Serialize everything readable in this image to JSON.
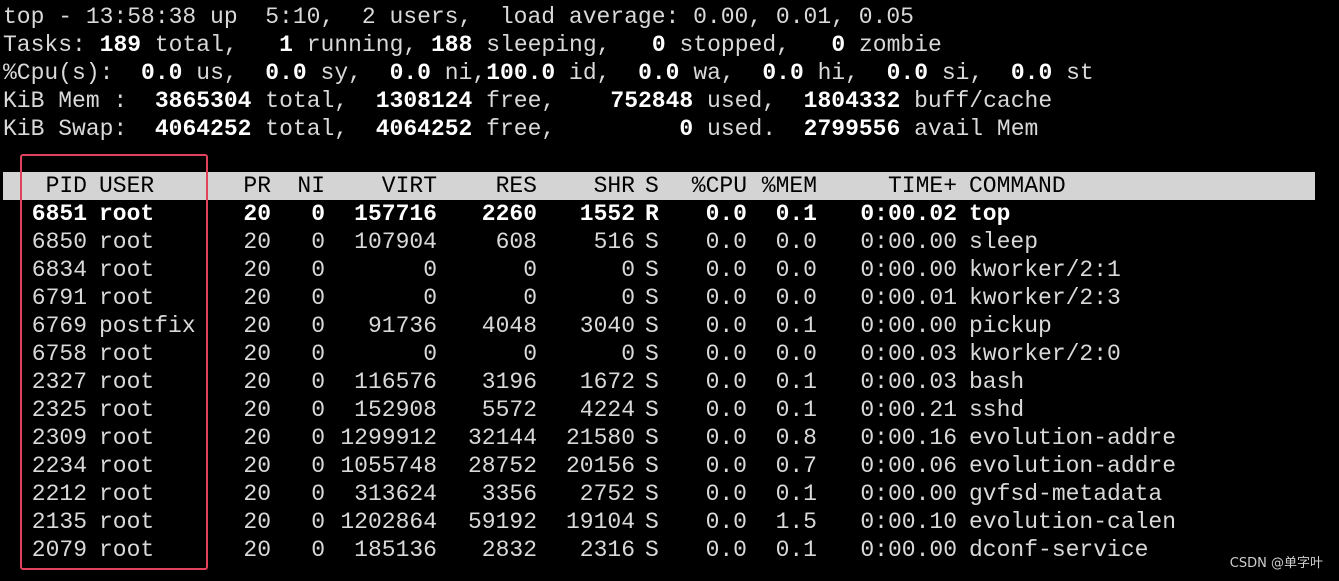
{
  "summary": {
    "line1": "top - 13:58:38 up  5:10,  2 users,  load average: 0.00, 0.01, 0.05",
    "tasks": {
      "label": "Tasks:",
      "total": "189",
      "total_label": "total,",
      "running": "1",
      "running_label": "running,",
      "sleeping": "188",
      "sleeping_label": "sleeping,",
      "stopped": "0",
      "stopped_label": "stopped,",
      "zombie": "0",
      "zombie_label": "zombie"
    },
    "cpu": {
      "label": "%Cpu(s):",
      "us": "0.0",
      "us_label": "us,",
      "sy": "0.0",
      "sy_label": "sy,",
      "ni": "0.0",
      "ni_label": "ni,",
      "id": "100.0",
      "id_label": "id,",
      "wa": "0.0",
      "wa_label": "wa,",
      "hi": "0.0",
      "hi_label": "hi,",
      "si": "0.0",
      "si_label": "si,",
      "st": "0.0",
      "st_label": "st"
    },
    "mem": {
      "label": "KiB Mem :",
      "total": "3865304",
      "total_label": "total,",
      "free": "1308124",
      "free_label": "free,",
      "used": "752848",
      "used_label": "used,",
      "buff": "1804332",
      "buff_label": "buff/cache"
    },
    "swap": {
      "label": "KiB Swap:",
      "total": "4064252",
      "total_label": "total,",
      "free": "4064252",
      "free_label": "free,",
      "used": "0",
      "used_label": "used.",
      "avail": "2799556",
      "avail_label": "avail Mem"
    }
  },
  "columns": {
    "pid": "PID",
    "user": "USER",
    "pr": "PR",
    "ni": "NI",
    "virt": "VIRT",
    "res": "RES",
    "shr": "SHR",
    "s": "S",
    "cpu": "%CPU",
    "mem": "%MEM",
    "time": "TIME+",
    "command": "COMMAND"
  },
  "processes": [
    {
      "pid": "6851",
      "user": "root",
      "pr": "20",
      "ni": "0",
      "virt": "157716",
      "res": "2260",
      "shr": "1552",
      "s": "R",
      "cpu": "0.0",
      "mem": "0.1",
      "time": "0:00.02",
      "command": "top",
      "bold": true
    },
    {
      "pid": "6850",
      "user": "root",
      "pr": "20",
      "ni": "0",
      "virt": "107904",
      "res": "608",
      "shr": "516",
      "s": "S",
      "cpu": "0.0",
      "mem": "0.0",
      "time": "0:00.00",
      "command": "sleep"
    },
    {
      "pid": "6834",
      "user": "root",
      "pr": "20",
      "ni": "0",
      "virt": "0",
      "res": "0",
      "shr": "0",
      "s": "S",
      "cpu": "0.0",
      "mem": "0.0",
      "time": "0:00.00",
      "command": "kworker/2:1"
    },
    {
      "pid": "6791",
      "user": "root",
      "pr": "20",
      "ni": "0",
      "virt": "0",
      "res": "0",
      "shr": "0",
      "s": "S",
      "cpu": "0.0",
      "mem": "0.0",
      "time": "0:00.01",
      "command": "kworker/2:3"
    },
    {
      "pid": "6769",
      "user": "postfix",
      "pr": "20",
      "ni": "0",
      "virt": "91736",
      "res": "4048",
      "shr": "3040",
      "s": "S",
      "cpu": "0.0",
      "mem": "0.1",
      "time": "0:00.00",
      "command": "pickup"
    },
    {
      "pid": "6758",
      "user": "root",
      "pr": "20",
      "ni": "0",
      "virt": "0",
      "res": "0",
      "shr": "0",
      "s": "S",
      "cpu": "0.0",
      "mem": "0.0",
      "time": "0:00.03",
      "command": "kworker/2:0"
    },
    {
      "pid": "2327",
      "user": "root",
      "pr": "20",
      "ni": "0",
      "virt": "116576",
      "res": "3196",
      "shr": "1672",
      "s": "S",
      "cpu": "0.0",
      "mem": "0.1",
      "time": "0:00.03",
      "command": "bash"
    },
    {
      "pid": "2325",
      "user": "root",
      "pr": "20",
      "ni": "0",
      "virt": "152908",
      "res": "5572",
      "shr": "4224",
      "s": "S",
      "cpu": "0.0",
      "mem": "0.1",
      "time": "0:00.21",
      "command": "sshd"
    },
    {
      "pid": "2309",
      "user": "root",
      "pr": "20",
      "ni": "0",
      "virt": "1299912",
      "res": "32144",
      "shr": "21580",
      "s": "S",
      "cpu": "0.0",
      "mem": "0.8",
      "time": "0:00.16",
      "command": "evolution-addre"
    },
    {
      "pid": "2234",
      "user": "root",
      "pr": "20",
      "ni": "0",
      "virt": "1055748",
      "res": "28752",
      "shr": "20156",
      "s": "S",
      "cpu": "0.0",
      "mem": "0.7",
      "time": "0:00.06",
      "command": "evolution-addre"
    },
    {
      "pid": "2212",
      "user": "root",
      "pr": "20",
      "ni": "0",
      "virt": "313624",
      "res": "3356",
      "shr": "2752",
      "s": "S",
      "cpu": "0.0",
      "mem": "0.1",
      "time": "0:00.00",
      "command": "gvfsd-metadata"
    },
    {
      "pid": "2135",
      "user": "root",
      "pr": "20",
      "ni": "0",
      "virt": "1202864",
      "res": "59192",
      "shr": "19104",
      "s": "S",
      "cpu": "0.0",
      "mem": "1.5",
      "time": "0:00.10",
      "command": "evolution-calen"
    },
    {
      "pid": "2079",
      "user": "root",
      "pr": "20",
      "ni": "0",
      "virt": "185136",
      "res": "2832",
      "shr": "2316",
      "s": "S",
      "cpu": "0.0",
      "mem": "0.1",
      "time": "0:00.00",
      "command": "dconf-service"
    }
  ],
  "watermark": "CSDN @单字叶",
  "colors": {
    "background": "#000000",
    "text": "#d9d9d9",
    "header_bar": "#d4d4d4",
    "highlight_box": "#e0435b"
  }
}
